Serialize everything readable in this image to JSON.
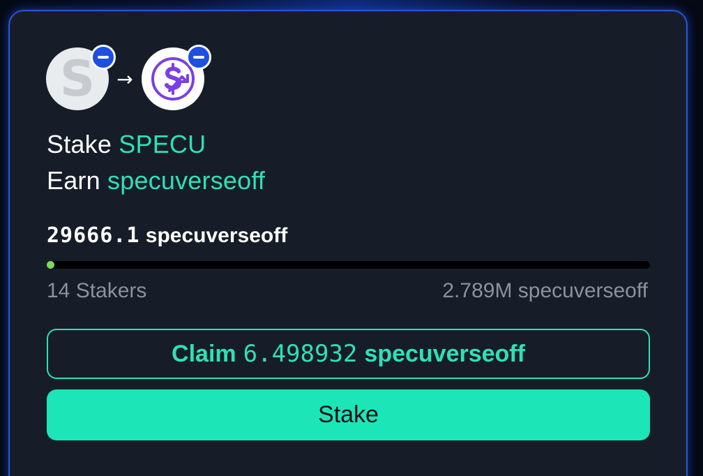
{
  "pool": {
    "stake_prefix": "Stake",
    "stake_token": "SPECU",
    "earn_prefix": "Earn",
    "earn_token": "specuverseoff"
  },
  "rewards": {
    "amount": "29666.1",
    "unit": "specuverseoff"
  },
  "progress": {
    "fraction": 0.005
  },
  "stats": {
    "stakers": "14 Stakers",
    "total": "2.789M specuverseoff"
  },
  "actions": {
    "claim_prefix": "Claim",
    "claim_amount": "6.498932",
    "claim_unit": "specuverseoff",
    "stake_label": "Stake"
  },
  "colors": {
    "accent": "#2fe0b5",
    "stake_button": "#1ce6b8",
    "progress_fill": "#7ed957",
    "badge": "#1d4fe0"
  },
  "icons": {
    "stake_token": "specu-s-icon",
    "earn_token": "specuverse-s-icon",
    "arrow": "arrow-right-icon",
    "badge": "minus-badge-icon"
  }
}
